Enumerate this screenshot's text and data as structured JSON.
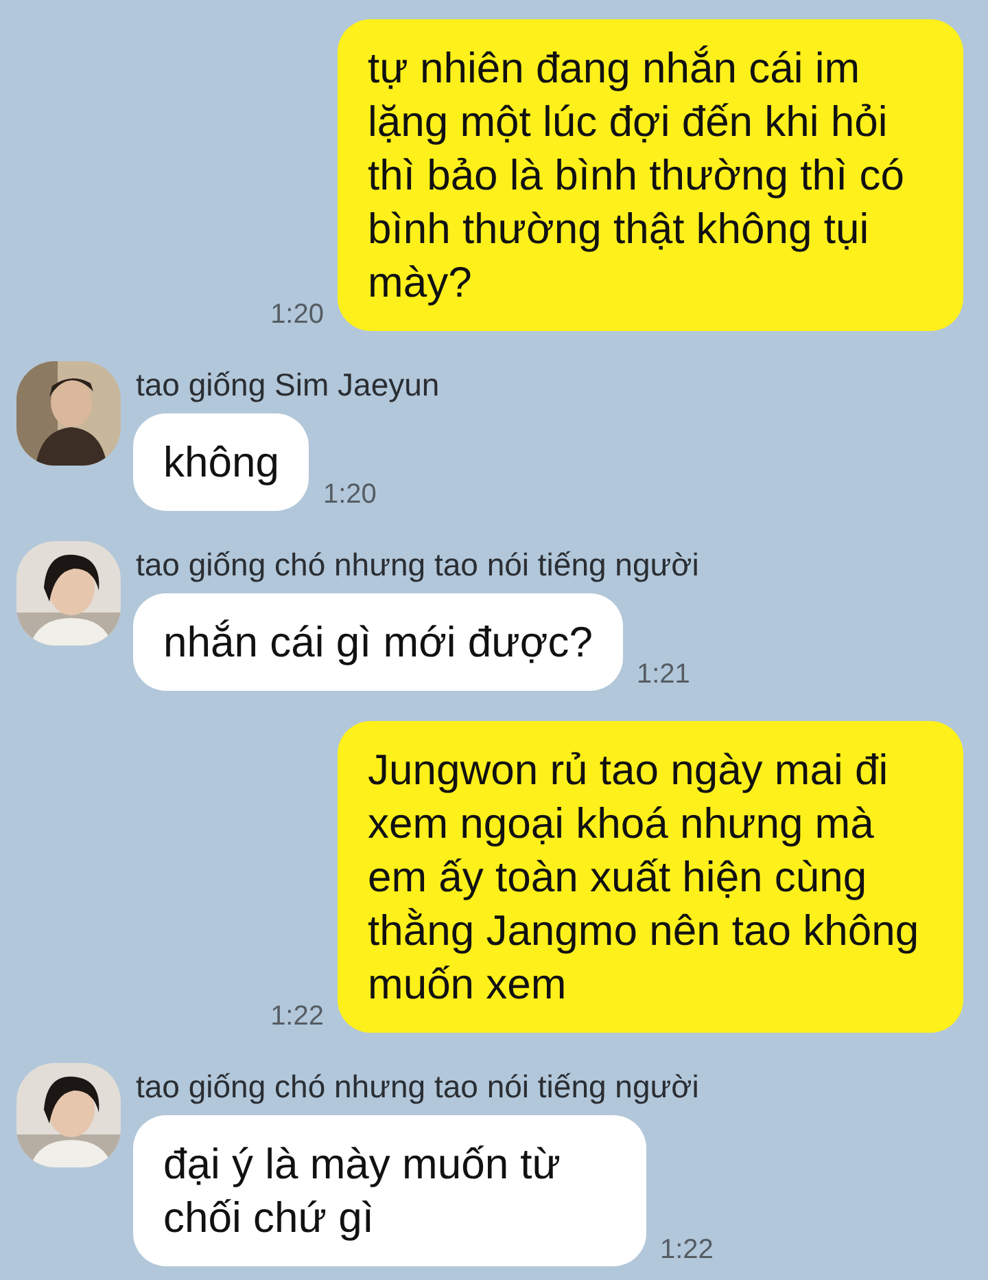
{
  "messages": [
    {
      "kind": "sent",
      "text": "tự nhiên đang nhắn cái im lặng một lúc đợi đến khi hỏi thì bảo là bình thường thì có bình thường thật không tụi mày?",
      "time": "1:20"
    },
    {
      "kind": "received",
      "sender": "tao giống Sim Jaeyun",
      "text": "không",
      "time": "1:20"
    },
    {
      "kind": "received",
      "sender": "tao giống chó nhưng tao nói tiếng người",
      "text": "nhắn cái gì mới được?",
      "time": "1:21"
    },
    {
      "kind": "sent",
      "text": "Jungwon rủ tao ngày mai đi xem ngoại khoá nhưng mà em ấy toàn xuất hiện cùng thằng Jangmo nên tao không muốn xem",
      "time": "1:22"
    },
    {
      "kind": "received",
      "sender": "tao giống chó nhưng tao nói tiếng người",
      "text": "đại ý là mày muốn từ chối chứ gì",
      "time": "1:22"
    }
  ]
}
